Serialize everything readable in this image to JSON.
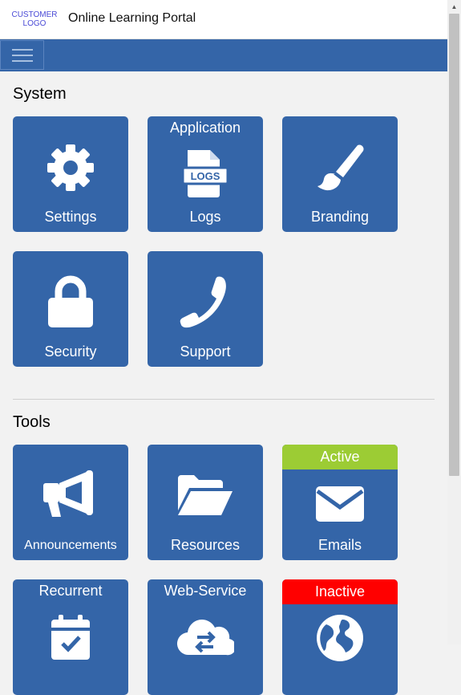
{
  "header": {
    "logo_line1": "CUSTOMER",
    "logo_line2": "LOGO",
    "title": "Online Learning Portal"
  },
  "sections": {
    "system": {
      "title": "System",
      "tiles": {
        "settings": {
          "label": "Settings",
          "icon": "gear-icon"
        },
        "logs": {
          "top_label": "Application",
          "label": "Logs",
          "icon": "logs-file-icon",
          "icon_text": "LOGS"
        },
        "branding": {
          "label": "Branding",
          "icon": "paintbrush-icon"
        },
        "security": {
          "label": "Security",
          "icon": "lock-icon"
        },
        "support": {
          "label": "Support",
          "icon": "phone-icon"
        }
      }
    },
    "tools": {
      "title": "Tools",
      "tiles": {
        "announcements": {
          "label": "Announcements",
          "icon": "megaphone-icon"
        },
        "resources": {
          "label": "Resources",
          "icon": "folder-open-icon"
        },
        "emails": {
          "badge": "Active",
          "label": "Emails",
          "icon": "envelope-icon"
        },
        "recurrent": {
          "top_label": "Recurrent",
          "icon": "calendar-icon"
        },
        "webservice": {
          "top_label": "Web-Service",
          "icon": "cloud-sync-icon"
        },
        "inactive": {
          "badge": "Inactive",
          "icon": "globe-icon"
        }
      }
    }
  },
  "colors": {
    "tile": "#3465a8",
    "active_badge": "#9ccc34",
    "inactive_badge": "#ff0000",
    "navbar": "#3465a8"
  }
}
